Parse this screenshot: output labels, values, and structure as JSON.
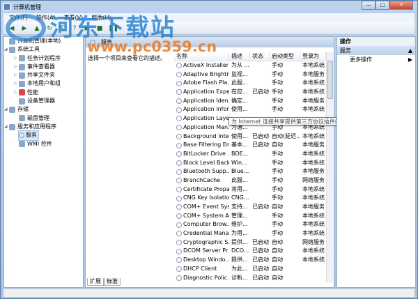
{
  "window": {
    "title": "计算机管理",
    "min": "—",
    "max": "□",
    "close": "✕"
  },
  "menu": [
    "文件(F)",
    "操作(A)",
    "查看(V)",
    "帮助(H)"
  ],
  "tree": {
    "root": "计算机管理(本地)",
    "system_tools": "系统工具",
    "items": [
      "任务计划程序",
      "事件查看器",
      "共享文件夹",
      "本地用户和组",
      "性能",
      "设备管理器"
    ],
    "storage": "存储",
    "disk": "磁盘管理",
    "services_apps": "服务和应用程序",
    "services": "服务",
    "wmi": "WMI 控件"
  },
  "middle": {
    "header": "服务",
    "description": "选择一个项目来查看它的描述。",
    "columns": [
      "名称",
      "描述",
      "状态",
      "启动类型",
      "登录为"
    ],
    "rows": [
      [
        "ActiveX Installer ...",
        "为从 ...",
        "",
        "手动",
        "本地系统"
      ],
      [
        "Adaptive Brightn...",
        "监视...",
        "",
        "手动",
        "本地服务"
      ],
      [
        "Adobe Flash Pla...",
        "此服...",
        "",
        "手动",
        "本地系统"
      ],
      [
        "Application Expe...",
        "在应...",
        "已启动",
        "手动",
        "本地系统"
      ],
      [
        "Application Iden...",
        "确定...",
        "",
        "手动",
        "本地服务"
      ],
      [
        "Application Infor...",
        "使用...",
        "",
        "手动",
        "本地系统"
      ],
      [
        "Application Laye...",
        "",
        "",
        "",
        ""
      ],
      [
        "Application Man...",
        "为通...",
        "",
        "手动",
        "本地系统"
      ],
      [
        "Background Inte...",
        "使用...",
        "已启动",
        "自动(延迟...",
        "本地系统"
      ],
      [
        "Base Filtering En...",
        "基本...",
        "已启动",
        "自动",
        "本地服务"
      ],
      [
        "BitLocker Drive ...",
        "BDE...",
        "",
        "手动",
        "本地系统"
      ],
      [
        "Block Level Back...",
        "Win...",
        "",
        "手动",
        "本地系统"
      ],
      [
        "Bluetooth Supp...",
        "Blue...",
        "",
        "手动",
        "本地服务"
      ],
      [
        "BranchCache",
        "此服...",
        "",
        "手动",
        "网络服务"
      ],
      [
        "Certificate Propa...",
        "将用...",
        "",
        "手动",
        "本地系统"
      ],
      [
        "CNG Key Isolation",
        "CNG...",
        "",
        "手动",
        "本地系统"
      ],
      [
        "COM+ Event Sys...",
        "支持...",
        "已启动",
        "自动",
        "本地服务"
      ],
      [
        "COM+ System A...",
        "管理...",
        "",
        "手动",
        "本地系统"
      ],
      [
        "Computer Brow...",
        "维护...",
        "",
        "手动",
        "本地系统"
      ],
      [
        "Credential Mana...",
        "为用...",
        "",
        "手动",
        "本地系统"
      ],
      [
        "Cryptographic S...",
        "提供...",
        "已启动",
        "自动",
        "网络服务"
      ],
      [
        "DCOM Server Pr...",
        "DCO...",
        "已启动",
        "自动",
        "本地系统"
      ],
      [
        "Desktop Windo...",
        "提供...",
        "已启动",
        "自动",
        "本地系统"
      ],
      [
        "DHCP Client",
        "为此...",
        "已启动",
        "自动",
        ""
      ],
      [
        "Diagnostic Polic...",
        "诊断...",
        "已启动",
        "自动",
        ""
      ]
    ],
    "tooltip": "为 Internet 连接共享提供第三方协议插件的支持",
    "tabs": [
      "扩展",
      "标准"
    ]
  },
  "actions": {
    "header": "操作",
    "section": "服务",
    "more": "更多操作"
  },
  "watermark": {
    "brand": "河东下载站",
    "url": "www.pc0359.cn"
  }
}
